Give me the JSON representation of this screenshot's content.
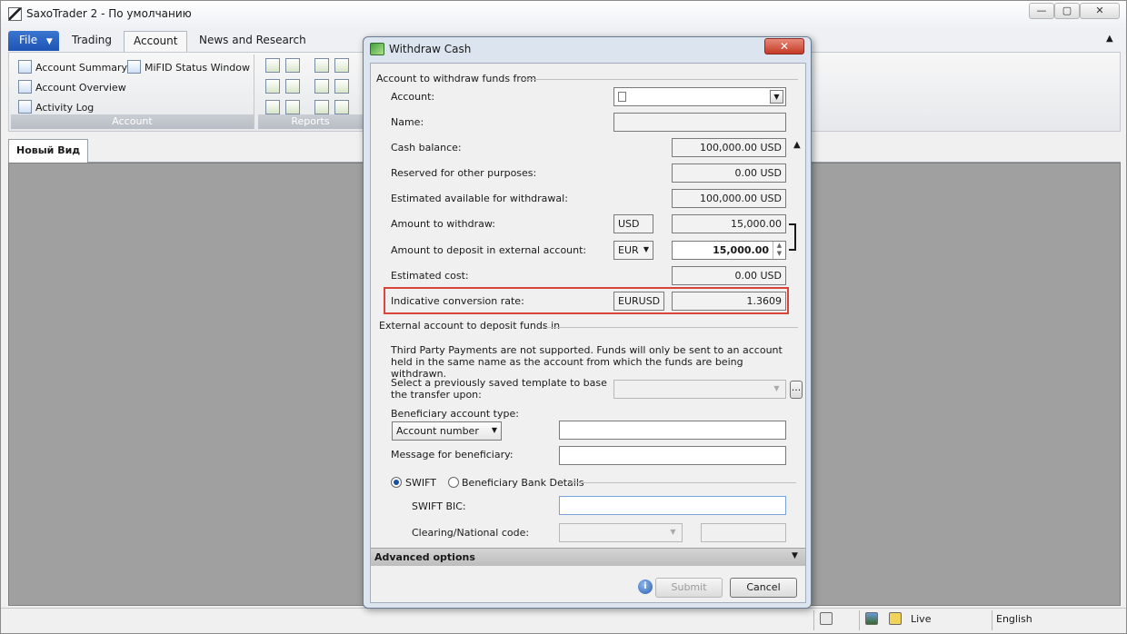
{
  "window": {
    "title": "SaxoTrader 2 - По умолчанию",
    "minimize": "—",
    "restore": "▢",
    "close": "✕"
  },
  "ribbon": {
    "file_label": "File",
    "tabs": [
      "Trading",
      "Account",
      "News and Research"
    ],
    "collapse": "▲",
    "account_group": {
      "label": "Account",
      "items": [
        "Account Summary",
        "MiFID Status Window",
        "Account Overview",
        "Activity Log"
      ]
    },
    "reports_group": {
      "label": "Reports"
    }
  },
  "workspace": {
    "view_tab": "Новый Вид"
  },
  "statusbar": {
    "connection": "Live",
    "language": "English"
  },
  "dialog": {
    "title": "Withdraw Cash",
    "close": "✕",
    "section_from": "Account to withdraw funds from",
    "labels": {
      "account": "Account:",
      "name": "Name:",
      "cash_balance": "Cash balance:",
      "reserved": "Reserved for other purposes:",
      "estimated_available": "Estimated available for withdrawal:",
      "amount_withdraw": "Amount to withdraw:",
      "amount_deposit": "Amount to deposit in external account:",
      "estimated_cost": "Estimated cost:",
      "conversion_rate": "Indicative conversion rate:"
    },
    "values": {
      "account": "",
      "name": "",
      "cash_balance": "100,000.00 USD",
      "reserved": "0.00 USD",
      "estimated_available": "100,000.00 USD",
      "withdraw_currency": "USD",
      "amount_withdraw": "15,000.00",
      "deposit_currency": "EUR",
      "amount_deposit": "15,000.00",
      "estimated_cost": "0.00 USD",
      "conversion_pair": "EURUSD",
      "conversion_rate": "1.3609"
    },
    "section_external": "External account to deposit funds in",
    "third_party_note": "Third Party Payments are not supported. Funds will only be sent to an account held in the same name as the account from which the funds are being withdrawn.",
    "template_label_1": "Select a previously saved template to base",
    "template_label_2": "the transfer upon:",
    "template_browse": "...",
    "beneficiary_type_label": "Beneficiary account type:",
    "beneficiary_type_value": "Account number",
    "message_label": "Message for beneficiary:",
    "swift_option": "SWIFT",
    "bank_details_option": "Beneficiary Bank Details",
    "swift_bic_label": "SWIFT BIC:",
    "clearing_label": "Clearing/National code:",
    "advanced_options": "Advanced options",
    "submit": "Submit",
    "cancel": "Cancel",
    "info_icon": "i"
  }
}
